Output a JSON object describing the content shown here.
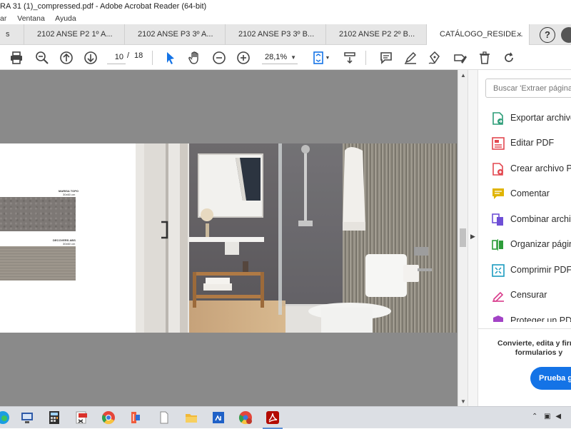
{
  "window": {
    "title": "RA 31 (1)_compressed.pdf - Adobe Acrobat Reader (64-bit)"
  },
  "menu": {
    "items": [
      "ar",
      "Ventana",
      "Ayuda"
    ]
  },
  "tabs": [
    {
      "label": "s"
    },
    {
      "label": "2102 ANSE P2 1º A..."
    },
    {
      "label": "2102 ANSE P3 3º A..."
    },
    {
      "label": "2102 ANSE P3 3º B..."
    },
    {
      "label": "2102 ANSE P2 2º B..."
    },
    {
      "label": "CATÁLOGO_RESIDE...",
      "active": true,
      "close": "×"
    }
  ],
  "header_actions": {
    "help": "?"
  },
  "toolbar": {
    "page_current": "10",
    "page_separator": "/",
    "page_total": "18",
    "zoom": "28,1%",
    "zoom_dropdown": "▼"
  },
  "document": {
    "swatch1_label": "MARISA TOPO",
    "swatch1_sub": "30x60 cm",
    "swatch2_label": "DECOVERS ABS",
    "swatch2_sub": "30x60 cm"
  },
  "tools_pane": {
    "search_placeholder": "Buscar 'Extraer página'",
    "items": [
      {
        "label": "Exportar archivo",
        "icon": "export-pdf-icon",
        "color": "#2d9d78"
      },
      {
        "label": "Editar PDF",
        "icon": "edit-pdf-icon",
        "color": "#e34850"
      },
      {
        "label": "Crear archivo PDF",
        "icon": "create-pdf-icon",
        "color": "#e34850"
      },
      {
        "label": "Comentar",
        "icon": "comment-icon",
        "color": "#e0b400"
      },
      {
        "label": "Combinar archivos",
        "icon": "combine-files-icon",
        "color": "#6e4fd6"
      },
      {
        "label": "Organizar páginas",
        "icon": "organize-pages-icon",
        "color": "#2d9d3a"
      },
      {
        "label": "Comprimir PDF",
        "icon": "compress-pdf-icon",
        "color": "#1a9bbf"
      },
      {
        "label": "Censurar",
        "icon": "redact-icon",
        "color": "#d93c8c"
      },
      {
        "label": "Proteger un PDF",
        "icon": "protect-icon",
        "color": "#a343c6"
      }
    ],
    "promo_text": "Convierte, edita y firma formularios y",
    "trial_button": "Prueba gratis"
  },
  "taskbar": {
    "tray_chevron": "⌃"
  },
  "colors": {
    "accent": "#1473e6",
    "doc_background": "#8a8a8a"
  }
}
